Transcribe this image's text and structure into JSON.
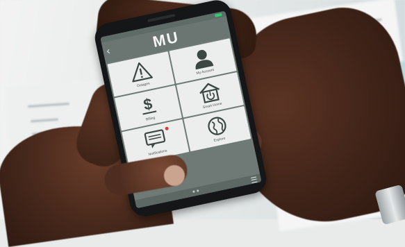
{
  "app": {
    "logo_text": "MU",
    "back_icon": "chevron-left-icon",
    "menu_icon": "hamburger-menu-icon",
    "battery_color": "#2ecc71"
  },
  "tiles": [
    {
      "label": "Outages",
      "icon": "warning-triangle-icon"
    },
    {
      "label": "My Account",
      "icon": "user-silhouette-icon"
    },
    {
      "label": "Billing",
      "icon": "dollar-sign-icon"
    },
    {
      "label": "Smart Home",
      "icon": "home-power-icon"
    },
    {
      "label": "Notifications",
      "icon": "message-bubble-icon",
      "badge": true
    },
    {
      "label": "Explore",
      "icon": "globe-icon"
    }
  ],
  "colors": {
    "header_bg": "#6b7672",
    "tile_bg": "#eceeed",
    "icon_color": "#3c4643",
    "badge_color": "#d63b3b"
  }
}
